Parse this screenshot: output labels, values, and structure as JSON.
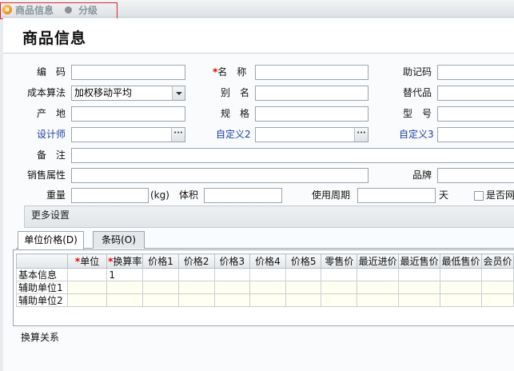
{
  "breadcrumb": {
    "item1": "商品信息",
    "item2": "分级",
    "logo_text": "a"
  },
  "page_title": "商品信息",
  "fields": {
    "code": {
      "label": "编　码",
      "value": ""
    },
    "name": {
      "label": "名　称",
      "required": "*",
      "value": ""
    },
    "mnemonic": {
      "label": "助记码",
      "value": ""
    },
    "cost_method": {
      "label": "成本算法",
      "value": "加权移动平均"
    },
    "alias": {
      "label": "别　名",
      "value": ""
    },
    "substitute": {
      "label": "替代品",
      "value": ""
    },
    "origin": {
      "label": "产　地",
      "value": ""
    },
    "spec": {
      "label": "规　格",
      "value": ""
    },
    "model": {
      "label": "型　号",
      "value": ""
    },
    "designer": {
      "label": "设计师",
      "value": ""
    },
    "custom2": {
      "label": "自定义2",
      "value": ""
    },
    "custom3": {
      "label": "自定义3",
      "value": ""
    },
    "remark": {
      "label": "备　注",
      "value": ""
    },
    "sales_attr": {
      "label": "销售属性",
      "value": ""
    },
    "brand": {
      "label": "品牌",
      "value": ""
    },
    "weight": {
      "label": "重量",
      "unit": "(kg)",
      "value": ""
    },
    "volume": {
      "label": "体积",
      "value": ""
    },
    "usage_period": {
      "label": "使用周期",
      "unit": "天",
      "value": ""
    },
    "is_network": {
      "label": "是否网",
      "checked": false
    }
  },
  "more_settings": "更多设置",
  "tabs": [
    {
      "label": "单位价格(D)",
      "active": true
    },
    {
      "label": "条码(O)",
      "active": false
    }
  ],
  "grid": {
    "columns": [
      {
        "label": "",
        "required": ""
      },
      {
        "label": "单位",
        "required": "*"
      },
      {
        "label": "换算率",
        "required": "*"
      },
      {
        "label": "价格1",
        "required": ""
      },
      {
        "label": "价格2",
        "required": ""
      },
      {
        "label": "价格3",
        "required": ""
      },
      {
        "label": "价格4",
        "required": ""
      },
      {
        "label": "价格5",
        "required": ""
      },
      {
        "label": "零售价",
        "required": ""
      },
      {
        "label": "最近进价",
        "required": ""
      },
      {
        "label": "最近售价",
        "required": ""
      },
      {
        "label": "最低售价",
        "required": ""
      },
      {
        "label": "会员价",
        "required": ""
      }
    ],
    "rows": [
      [
        "基本信息",
        "",
        "1",
        "",
        "",
        "",
        "",
        "",
        "",
        "",
        "",
        "",
        ""
      ],
      [
        "辅助单位1",
        "",
        "",
        "",
        "",
        "",
        "",
        "",
        "",
        "",
        "",
        "",
        ""
      ],
      [
        "辅助单位2",
        "",
        "",
        "",
        "",
        "",
        "",
        "",
        "",
        "",
        "",
        "",
        ""
      ]
    ]
  },
  "conversion_label": "换算关系",
  "colors": {
    "required": "#e00000",
    "link_label": "#1a3fa8",
    "highlight_box": "#e0242f"
  }
}
